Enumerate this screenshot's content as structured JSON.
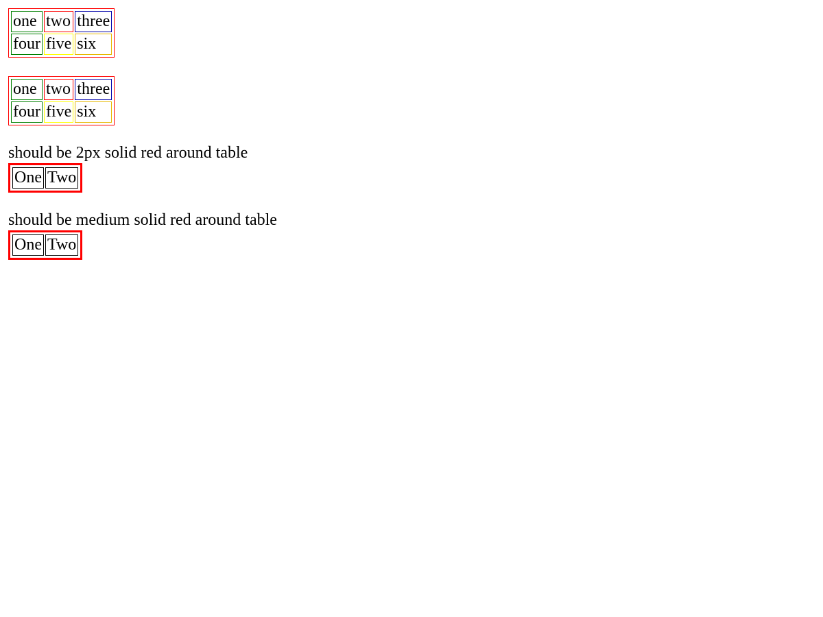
{
  "table1": {
    "rows": [
      [
        {
          "text": "one",
          "border_color": "#008000"
        },
        {
          "text": "two",
          "border_color": "#ff0000"
        },
        {
          "text": "three",
          "border_color": "#0000aa"
        }
      ],
      [
        {
          "text": "four",
          "border_color": "#008000"
        },
        {
          "text": "five",
          "border_color": "#ffff00"
        },
        {
          "text": "six",
          "border_color": "#e6b800"
        }
      ]
    ],
    "outer_border_color": "#ff0000"
  },
  "table2": {
    "rows": [
      [
        {
          "text": "one",
          "border_color": "#008000"
        },
        {
          "text": "two",
          "border_color": "#ff0000"
        },
        {
          "text": "three",
          "border_color": "#0000aa"
        }
      ],
      [
        {
          "text": "four",
          "border_color": "#008000"
        },
        {
          "text": "five",
          "border_color": "#ffff00"
        },
        {
          "text": "six",
          "border_color": "#e6b800"
        }
      ]
    ],
    "outer_border_color": "#ff0000"
  },
  "section3": {
    "caption": "should be 2px solid red around table",
    "cells": [
      "One",
      "Two"
    ],
    "outer_border_color": "#ff0000"
  },
  "section4": {
    "caption": "should be medium solid red around table",
    "cells": [
      "One",
      "Two"
    ],
    "outer_border_color": "#ff0000"
  }
}
